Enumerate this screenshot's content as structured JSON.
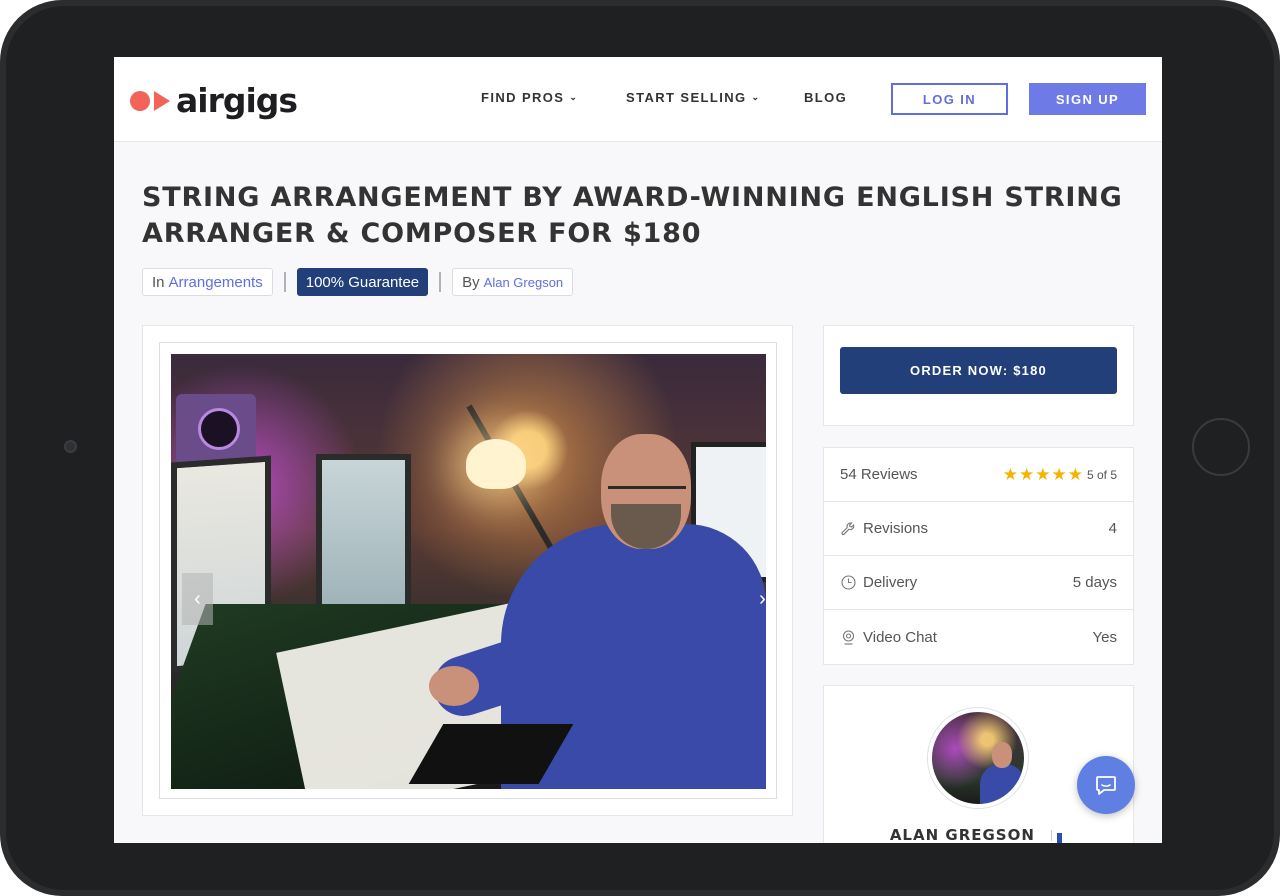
{
  "brand": {
    "name": "airgigs",
    "color": "#f2645a"
  },
  "nav": {
    "find_pros": "FIND PROS",
    "start_selling": "START SELLING",
    "blog": "BLOG",
    "login": "LOG IN",
    "signup": "SIGN UP"
  },
  "gig": {
    "title": "STRING ARRANGEMENT BY AWARD-WINNING ENGLISH STRING ARRANGER & COMPOSER FOR $180",
    "category_prefix": "In",
    "category": "Arrangements",
    "guarantee": "100% Guarantee",
    "by_prefix": "By",
    "seller": "Alan Gregson"
  },
  "gallery": {
    "prev_icon": "chevron-left-icon",
    "next_icon": "chevron-right-icon"
  },
  "order": {
    "button_label": "ORDER NOW: $180"
  },
  "stats": {
    "reviews_label": "54 Reviews",
    "rating_value": 5,
    "rating_text": "5 of 5",
    "revisions_label": "Revisions",
    "revisions_value": "4",
    "delivery_label": "Delivery",
    "delivery_value": "5 days",
    "videochat_label": "Video Chat",
    "videochat_value": "Yes"
  },
  "profile": {
    "name": "ALAN GREGSON"
  },
  "colors": {
    "accent": "#6e7be6",
    "primary_dark": "#223f7a",
    "star": "#f5b301",
    "chat": "#5f7fe2"
  }
}
